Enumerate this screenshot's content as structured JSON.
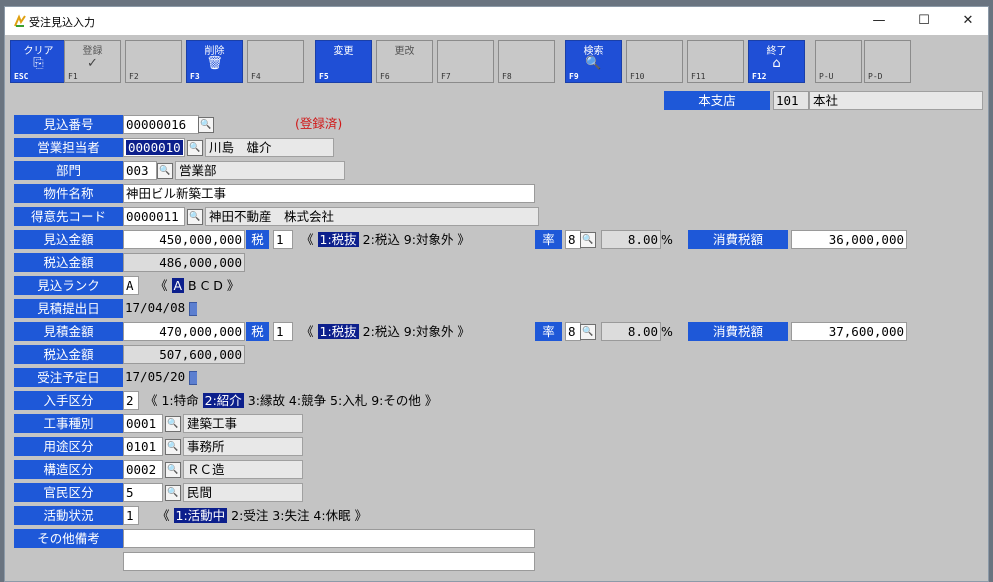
{
  "window": {
    "title": "受注見込入力",
    "min_icon": "—",
    "max_icon": "☐",
    "close_icon": "✕"
  },
  "toolbar": [
    {
      "label": "クリア",
      "key": "ESC",
      "icon": "⎘",
      "active": true
    },
    {
      "label": "登録",
      "key": "F1",
      "icon": "✓",
      "active": false
    },
    {
      "label": "",
      "key": "F2",
      "icon": "",
      "active": false
    },
    {
      "label": "削除",
      "key": "F3",
      "icon": "🗑",
      "active": true
    },
    {
      "label": "",
      "key": "F4",
      "icon": "",
      "active": false
    },
    {
      "label": "変更",
      "key": "F5",
      "icon": "",
      "active": true
    },
    {
      "label": "更改",
      "key": "F6",
      "icon": "",
      "active": false
    },
    {
      "label": "",
      "key": "F7",
      "icon": "",
      "active": false
    },
    {
      "label": "",
      "key": "F8",
      "icon": "",
      "active": false
    },
    {
      "label": "検索",
      "key": "F9",
      "icon": "🔍",
      "active": true
    },
    {
      "label": "",
      "key": "F10",
      "icon": "",
      "active": false
    },
    {
      "label": "",
      "key": "F11",
      "icon": "",
      "active": false
    },
    {
      "label": "終了",
      "key": "F12",
      "icon": "⌂",
      "active": true
    },
    {
      "label": "",
      "key": "P-U",
      "icon": "",
      "active": false
    },
    {
      "label": "",
      "key": "P-D",
      "icon": "",
      "active": false
    }
  ],
  "branch": {
    "label": "本支店",
    "code": "101",
    "name": "本社"
  },
  "labels": {
    "mikomi_no": "見込番号",
    "tantou": "営業担当者",
    "bumon": "部門",
    "bukken": "物件名称",
    "tokui": "得意先コード",
    "mikomi_kingaku": "見込金額",
    "zeikomi": "税込金額",
    "rank": "見込ランク",
    "teishutsu": "見積提出日",
    "mitsumori_kingaku": "見積金額",
    "zeikomi2": "税込金額",
    "juchu_date": "受注予定日",
    "nyushu": "入手区分",
    "koji_shubetsu": "工事種別",
    "youto": "用途区分",
    "kouzou": "構造区分",
    "kanmin": "官民区分",
    "katsudou": "活動状況",
    "biko": "その他備考"
  },
  "values": {
    "mikomi_no": "00000016",
    "status": "(登録済)",
    "tantou_code": "0000010",
    "tantou_name": "川島　雄介",
    "bumon_code": "003",
    "bumon_name": "営業部",
    "bukken": "神田ビル新築工事",
    "tokui_code": "0000011",
    "tokui_name": "神田不動産　株式会社",
    "mikomi_kingaku": "450,000,000",
    "zeikomi": "486,000,000",
    "rank": "A",
    "teishutsu": "17/04/08",
    "mitsumori_kingaku": "470,000,000",
    "zeikomi2": "507,600,000",
    "juchu_date": "17/05/20",
    "nyushu_code": "2",
    "koji_code": "0001",
    "koji_name": "建築工事",
    "youto_code": "0101",
    "youto_name": "事務所",
    "kouzou_code": "0002",
    "kouzou_name": "ＲＣ造",
    "kanmin_code": "5",
    "kanmin_name": "民間",
    "katsudou_code": "1",
    "biko1": "",
    "biko2": ""
  },
  "tax": {
    "zei_label": "税",
    "zei_code": "1",
    "opt_open": "《",
    "opt1": "1:税抜",
    "opt_rest": "2:税込 9:対象外 》",
    "ritsu_label": "率",
    "ritsu_code": "8",
    "ritsu_value": "8.00",
    "percent": "%",
    "shouhizei_label": "消費税額",
    "shouhizei1": "36,000,000",
    "shouhizei2": "37,600,000"
  },
  "rank_options": {
    "open": "《",
    "selected": "A",
    "rest": "B C D 》"
  },
  "nyushu_options": {
    "open": "《 1:特命",
    "selected": "2:紹介",
    "rest": "3:縁故 4:競争 5:入札 9:その他 》"
  },
  "katsudou_options": {
    "open": "《",
    "selected": "1:活動中",
    "rest": "2:受注 3:失注 4:休眠 》"
  },
  "colors": {
    "label_bg": "#1e58d8",
    "selected_bg": "#0c1f8c",
    "form_bg": "#c4c4c4"
  }
}
